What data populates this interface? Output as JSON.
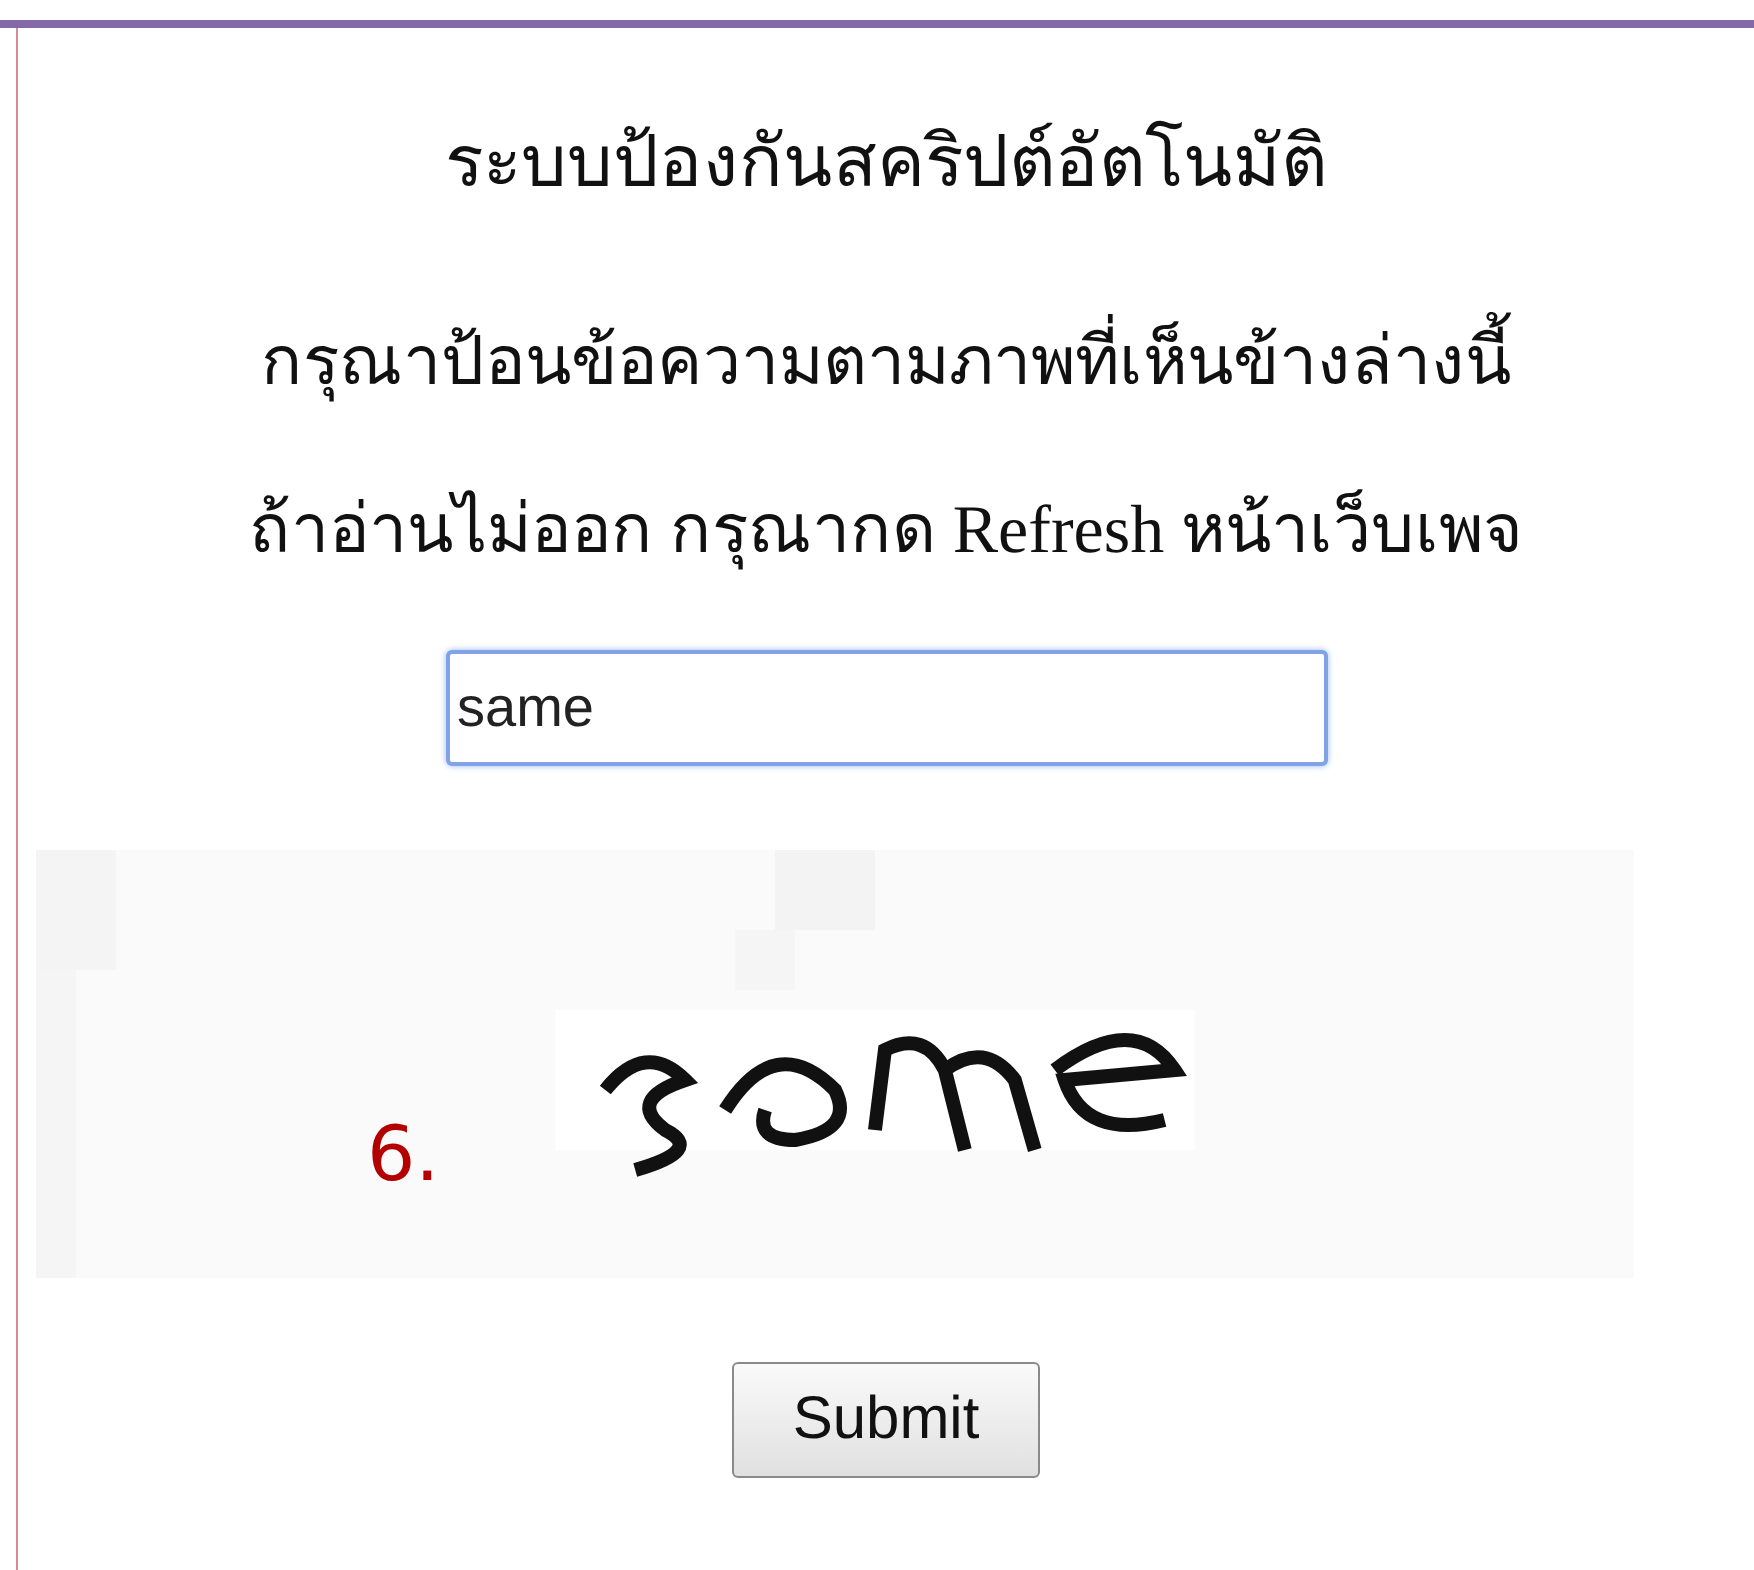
{
  "title": "ระบบป้องกันสคริปต์อัตโนมัติ",
  "instructions": [
    "กรุณาป้อนข้อความตามภาพที่เห็นข้างล่างนี้",
    "ถ้าอ่านไม่ออก กรุณากด Refresh หน้าเว็บเพจ"
  ],
  "answer_field": {
    "value": "same",
    "focused": true
  },
  "annotation": "6.",
  "submit_button": "Submit"
}
